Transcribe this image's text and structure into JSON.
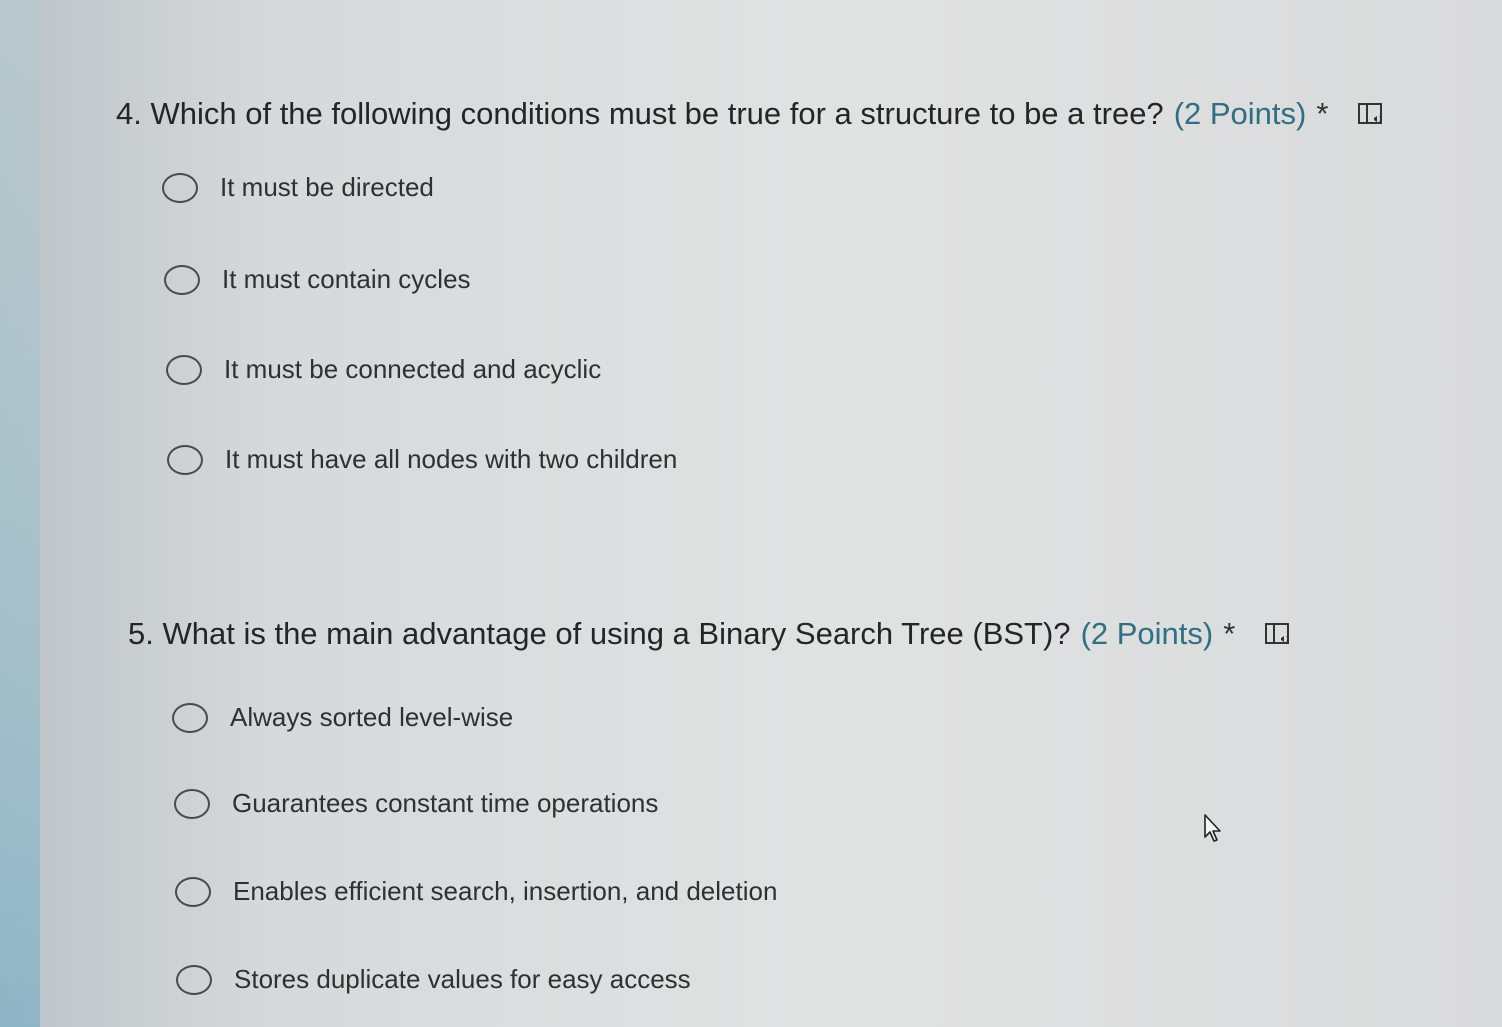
{
  "questions": [
    {
      "number": "4.",
      "text": "Which of the following conditions must be true for a structure to be a tree?",
      "points": "(2 Points)",
      "required": "*",
      "icon": "immersive-reader-icon",
      "options": [
        "It must be directed",
        "It must contain cycles",
        "It must be connected and acyclic",
        "It must have all nodes with two children"
      ]
    },
    {
      "number": "5.",
      "text": "What is the main advantage of using a Binary Search Tree (BST)?",
      "points": "(2 Points)",
      "required": "*",
      "icon": "immersive-reader-icon",
      "options": [
        "Always sorted level-wise",
        "Guarantees constant time operations",
        "Enables efficient search, insertion, and deletion",
        "Stores duplicate values for easy access"
      ]
    }
  ],
  "cursor": "mouse-pointer-icon"
}
